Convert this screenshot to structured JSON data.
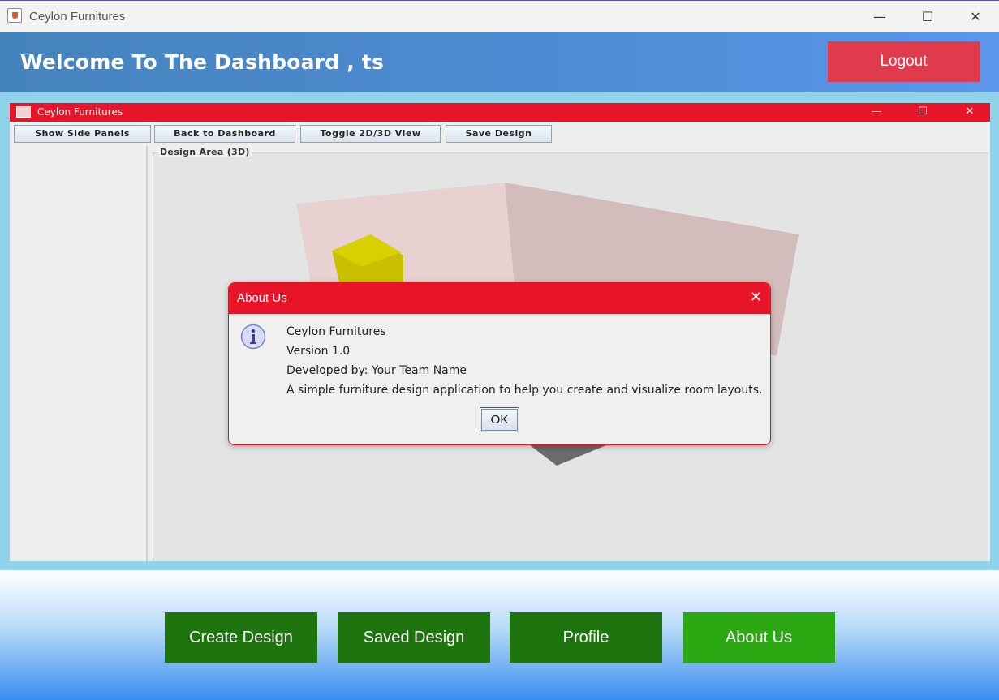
{
  "window": {
    "title": "Ceylon Furnitures",
    "controls": {
      "minimize": "—",
      "maximize": "☐",
      "close": "✕"
    }
  },
  "header": {
    "welcome": "Welcome To The Dashboard , ts",
    "logout_label": "Logout"
  },
  "inner_window": {
    "title": "Ceylon Furnitures",
    "controls": {
      "minimize": "—",
      "maximize": "☐",
      "close": "✕"
    },
    "toolbar": [
      {
        "label": "Show Side Panels"
      },
      {
        "label": "Back to Dashboard"
      },
      {
        "label": "Toggle 2D/3D View"
      },
      {
        "label": "Save Design"
      }
    ],
    "design_area_label": "Design Area (3D)"
  },
  "dialog": {
    "title": "About Us",
    "close": "✕",
    "lines": [
      "Ceylon Furnitures",
      "Version 1.0",
      "Developed by: Your Team Name",
      "A simple furniture design application to help you create and visualize room layouts."
    ],
    "ok_label": "OK"
  },
  "nav": [
    {
      "label": "Create Design",
      "color": "#1e740e"
    },
    {
      "label": "Saved Design",
      "color": "#1e740e"
    },
    {
      "label": "Profile",
      "color": "#1e740e"
    },
    {
      "label": "About Us",
      "color": "#2ba812"
    }
  ],
  "colors": {
    "accent_red": "#e81427",
    "logout": "#e03a4d",
    "header_blue": "#4f8bd3"
  }
}
